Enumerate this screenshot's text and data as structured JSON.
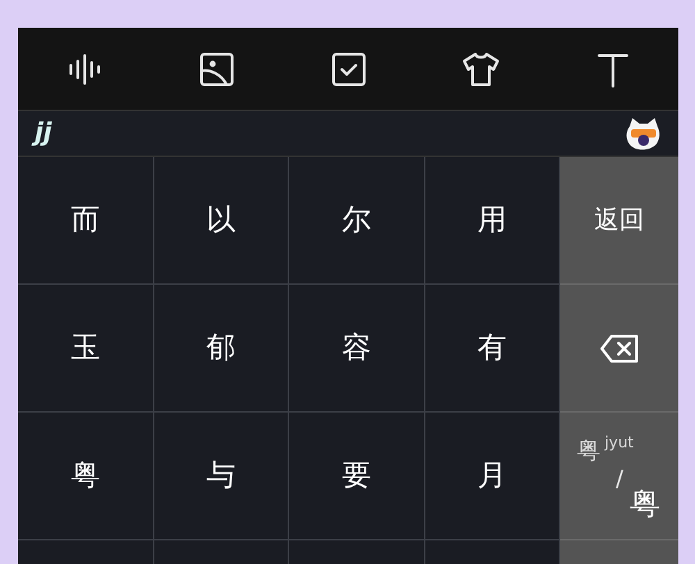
{
  "toolbar": [
    {
      "kind": "voice"
    },
    {
      "kind": "image"
    },
    {
      "kind": "check"
    },
    {
      "kind": "shirt"
    },
    {
      "kind": "text"
    }
  ],
  "candidate_bar": {
    "logo": "jj"
  },
  "keys": [
    [
      "而",
      "以",
      "尔",
      "用"
    ],
    [
      "玉",
      "郁",
      "容",
      "有"
    ],
    [
      "粤",
      "与",
      "要",
      "月"
    ]
  ],
  "side_keys": [
    {
      "kind": "label",
      "label": "返回"
    },
    {
      "kind": "backspace"
    },
    {
      "kind": "toggle",
      "small": "粤",
      "sup": "jyut",
      "slash": "/",
      "large": "粤"
    }
  ]
}
